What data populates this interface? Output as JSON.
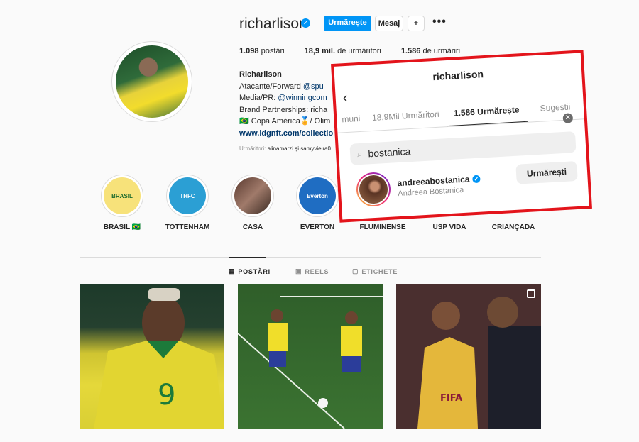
{
  "profile": {
    "username": "richarlison",
    "follow_label": "Urmărește",
    "message_label": "Mesaj",
    "add_icon": "+",
    "more_label": "•••",
    "verified_glyph": "✓",
    "stats": {
      "posts_count": "1.098",
      "posts_label": "postări",
      "followers_count": "18,9 mil.",
      "followers_label": "de urmăritori",
      "following_count": "1.586",
      "following_label": "de urmăriri"
    },
    "bio": {
      "name": "Richarlison",
      "line1_prefix": "Atacante/Forward ",
      "line1_link": "@spu",
      "line2_prefix": "Media/PR: ",
      "line2_link": "@winningcom",
      "line3": "Brand Partnerships: richa",
      "line4": "🇧🇷 Copa América🏅/ Olim",
      "website": "www.idgnft.com/collectio"
    },
    "followed_by_prefix": "Urmăritori: ",
    "followed_by_names": "alinamarzi și samyvieira0"
  },
  "highlights": [
    {
      "label": "BRASIL 🇧🇷",
      "badge": "BRASIL"
    },
    {
      "label": "TOTTENHAM",
      "badge": "THFC"
    },
    {
      "label": "CASA",
      "badge": ""
    },
    {
      "label": "EVERTON",
      "badge": "Everton"
    },
    {
      "label": "FLUMINENSE",
      "badge": ""
    },
    {
      "label": "USP VIDA",
      "badge": ""
    },
    {
      "label": "CRIANÇADA",
      "badge": ""
    }
  ],
  "tabs": {
    "posts": "POSTĂRI",
    "reels": "REELS",
    "tagged": "ETICHETE"
  },
  "overlay": {
    "title": "richarlison",
    "back_glyph": "‹",
    "tab_mutual": "muni",
    "tab_followers": "18,9Mil Urmăritori",
    "tab_following": "1.586 Urmărește",
    "tab_suggestions": "Sugestii",
    "search_value": "bostanica",
    "clear_glyph": "✕",
    "result": {
      "username": "andreeabostanica",
      "full_name": "Andreea Bostanica",
      "button_label": "Urmărești"
    }
  },
  "colors": {
    "accent": "#0095f6",
    "highlight_border": "#e3141b"
  }
}
